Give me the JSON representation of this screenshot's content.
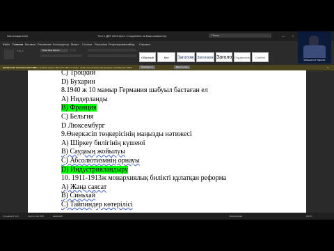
{
  "window": {
    "autosave": "Автосохранение",
    "title": "Тест к ДВТ 2023.docx • Сохранено на Ваш компьютер",
    "search_placeholder": "Поиск"
  },
  "menu": [
    "Файл",
    "Главная",
    "Вставка",
    "Рисование",
    "Конструктор",
    "Макет",
    "Ссылки",
    "Рассылки",
    "Рецензирование",
    "Вид",
    "Справка"
  ],
  "ribbon": {
    "font_name": "Times New Roman",
    "styles": [
      "Обычный",
      "Без интервала",
      "Заголовок 1",
      "Заголовок 2",
      "Заголовок",
      "Подзаголовок",
      "Слабое выдел."
    ]
  },
  "infobar": {
    "label": "ВНИМАНИЕ! ПРОБНАЯ ВЕРСИЯ",
    "text": "Ваша пробная версия Microsoft Office истекает. Чтобы использовать все функции, приобретите Office.",
    "buttons": [
      "Приобрести",
      "Ввести ключ"
    ]
  },
  "document": {
    "lines": [
      {
        "text": "С) Троцкий",
        "style": "normal"
      },
      {
        "text": "D) Бухарин",
        "style": "normal"
      },
      {
        "text": "8.1940 ж 10 мамыр Германия шабуыл бастаған ел",
        "style": "normal"
      },
      {
        "text": "А) Нидерланды",
        "style": "normal"
      },
      {
        "text": "В) Франция",
        "style": "highlight"
      },
      {
        "text": "С) Бельгия",
        "style": "normal"
      },
      {
        "text": "D Люксембург",
        "style": "normal"
      },
      {
        "text": "9.Өнеркәсіп төңкерісінің маңызды нәтижесі",
        "style": "normal"
      },
      {
        "text": "А) Шіркеу билігінің күшеюі",
        "style": "normal"
      },
      {
        "text": "В) Саудаың жойылуы",
        "style": "underline"
      },
      {
        "text": "С) Абсолютизмнің орнауы",
        "style": "underline"
      },
      {
        "text": "D) Индустрияландыру",
        "style": "highlight"
      },
      {
        "text": "10. 1911-1913ж монархиялық билікті құлатқан реформа",
        "style": "normal"
      },
      {
        "text": "А) Жаңа саясат",
        "style": "underline"
      },
      {
        "text": "В) Синьхай",
        "style": "underline"
      },
      {
        "text": "С) Тайпиндер көтерілісі",
        "style": "underline"
      }
    ]
  },
  "status": {
    "page": "Страница 5 из 8",
    "words": "Число слов: 999",
    "lang": "казахский",
    "focus": "Фокусировка",
    "zoom": "140 %"
  },
  "webcam": {
    "caption": "Кабаева М.А. Мұғалім"
  }
}
